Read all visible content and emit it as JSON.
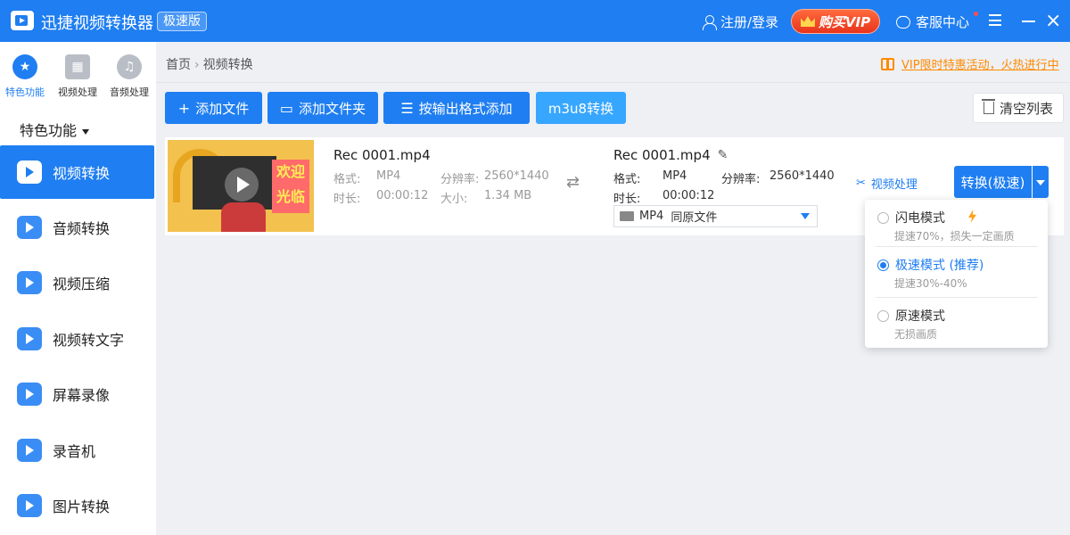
{
  "titlebar": {
    "app_title": "迅捷视频转换器",
    "edition": "极速版",
    "login": "注册/登录",
    "vip": "购买VIP",
    "service": "客服中心",
    "close": "×"
  },
  "sidebar": {
    "top_tabs": [
      {
        "label": "特色功能",
        "icon": "star-icon"
      },
      {
        "label": "视频处理",
        "icon": "film-icon"
      },
      {
        "label": "音频处理",
        "icon": "music-icon"
      }
    ],
    "section_title": "特色功能",
    "items": [
      {
        "label": "视频转换",
        "icon": "video-convert-icon"
      },
      {
        "label": "音频转换",
        "icon": "audio-convert-icon"
      },
      {
        "label": "视频压缩",
        "icon": "video-compress-icon"
      },
      {
        "label": "视频转文字",
        "icon": "video-to-text-icon"
      },
      {
        "label": "屏幕录像",
        "icon": "screen-record-icon"
      },
      {
        "label": "录音机",
        "icon": "recorder-icon"
      },
      {
        "label": "图片转换",
        "icon": "image-convert-icon"
      }
    ]
  },
  "breadcrumb": {
    "home": "首页",
    "sep": "›",
    "current": "视频转换"
  },
  "promo": "VIP限时特惠活动，火热进行中",
  "toolbar": {
    "add_file": "添加文件",
    "add_folder": "添加文件夹",
    "add_by_format": "按输出格式添加",
    "m3u8": "m3u8转换",
    "clear": "清空列表"
  },
  "file": {
    "source": {
      "name": "Rec 0001.mp4",
      "format_label": "格式:",
      "format": "MP4",
      "resolution_label": "分辨率:",
      "resolution": "2560*1440",
      "duration_label": "时长:",
      "duration": "00:00:12",
      "size_label": "大小:",
      "size": "1.34 MB"
    },
    "output": {
      "name": "Rec 0001.mp4",
      "format_label": "格式:",
      "format": "MP4",
      "resolution_label": "分辨率:",
      "resolution": "2560*1440",
      "duration_label": "时长:",
      "duration": "00:00:12",
      "select_format": "MP4",
      "select_quality": "同原文件"
    },
    "thumb_sign": "欢迎光临",
    "edit_link": "视频处理",
    "convert_button": "转换(极速)"
  },
  "speed_menu": {
    "options": [
      {
        "label": "闪电模式",
        "desc": "提速70%，损失一定画质",
        "selected": false
      },
      {
        "label": "极速模式 (推荐)",
        "desc": "提速30%-40%",
        "selected": true
      },
      {
        "label": "原速模式",
        "desc": "无损画质",
        "selected": false
      }
    ]
  },
  "colors": {
    "accent": "#1f7ef1",
    "vip": "#e8341c",
    "promo": "#ff8a00"
  }
}
